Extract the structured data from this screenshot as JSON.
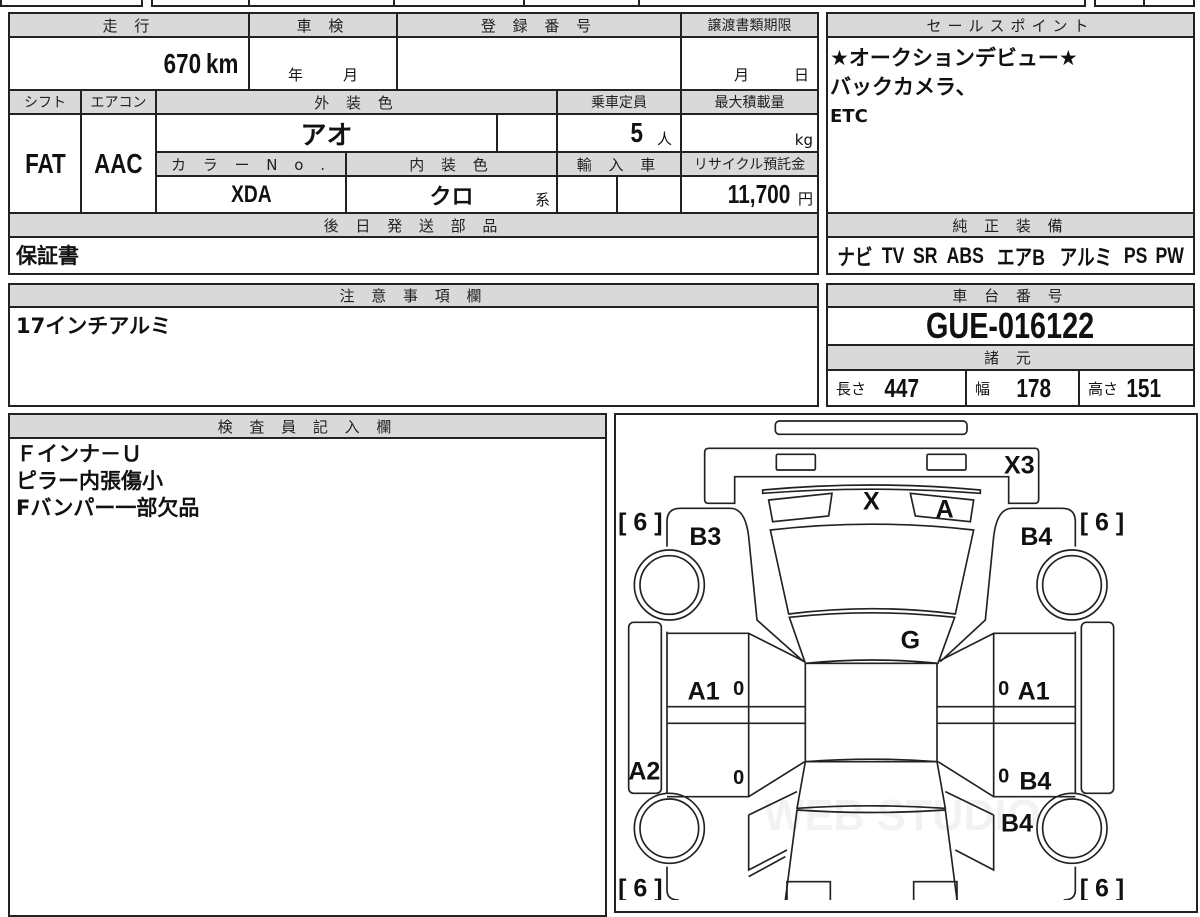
{
  "main_table": {
    "mileage_header": "走 行",
    "shaken_header": "車 検",
    "registration_header": "登 録 番 号",
    "transfer_deadline_header": "譲渡書類期限",
    "mileage_value": "670",
    "mileage_unit": "km",
    "shaken_year": "年",
    "shaken_month": "月",
    "transfer_month": "月",
    "transfer_day": "日",
    "shift_header": "シフト",
    "ac_header": "エアコン",
    "exterior_color_header": "外 装 色",
    "capacity_header": "乗車定員",
    "max_load_header": "最大積載量",
    "shift_value": "FAT",
    "ac_value": "AAC",
    "exterior_color_value": "アオ",
    "capacity_value": "5",
    "capacity_unit": "人",
    "max_load_unit": "kg",
    "color_no_header": "カ ラ ー N o .",
    "interior_color_header": "内 装 色",
    "import_header": "輸 入 車",
    "recycle_header": "リサイクル預託金",
    "color_no_value": "XDA",
    "interior_color_value": "クロ",
    "interior_color_suffix": "系",
    "recycle_value": "11,700",
    "recycle_unit": "円",
    "later_parts_header": "後 日 発 送 部 品",
    "later_parts_value": "保証書"
  },
  "sales_points": {
    "header": "セールスポイント",
    "lines": [
      "★オークションデビュー★",
      "バックカメラ、",
      "ETC"
    ]
  },
  "equipment": {
    "header": "純 正 装 備",
    "items": [
      "ナビ",
      "TV",
      "SR",
      "ABS",
      "エアB",
      "アルミ",
      "PS",
      "PW"
    ]
  },
  "notes": {
    "header": "注 意 事 項 欄",
    "value": "17インチアルミ"
  },
  "chassis": {
    "header": "車 台 番 号",
    "value": "GUE-016122",
    "specs_header": "諸 元",
    "length_label": "長さ",
    "length_value": "447",
    "width_label": "幅",
    "width_value": "178",
    "height_label": "高さ",
    "height_value": "151"
  },
  "inspector": {
    "header": "検 査 員 記 入 欄",
    "lines": [
      "Ｆインナ－Ｕ",
      "ピラー内張傷小",
      "Fバンパー一部欠品"
    ]
  },
  "diagram": {
    "tire_fl": "[ 6 ]",
    "tire_fr": "[ 6 ]",
    "tire_rl": "[ 6 ]",
    "tire_rr": "[ 6 ]",
    "front_bumper": "X3",
    "windshield_left": "X",
    "windshield_right": "A",
    "fender_left": "B3",
    "fender_right": "B4",
    "roof": "G",
    "front_door_left": "A1",
    "front_door_left_zero": "0",
    "front_door_right_zero": "0",
    "front_door_right": "A1",
    "sill_left": "A2",
    "rear_door_left_zero": "0",
    "rear_door_right_zero": "0",
    "rear_door_right": "B4",
    "rear_fender_right": "B4",
    "watermark": "WEB STUDIO"
  }
}
